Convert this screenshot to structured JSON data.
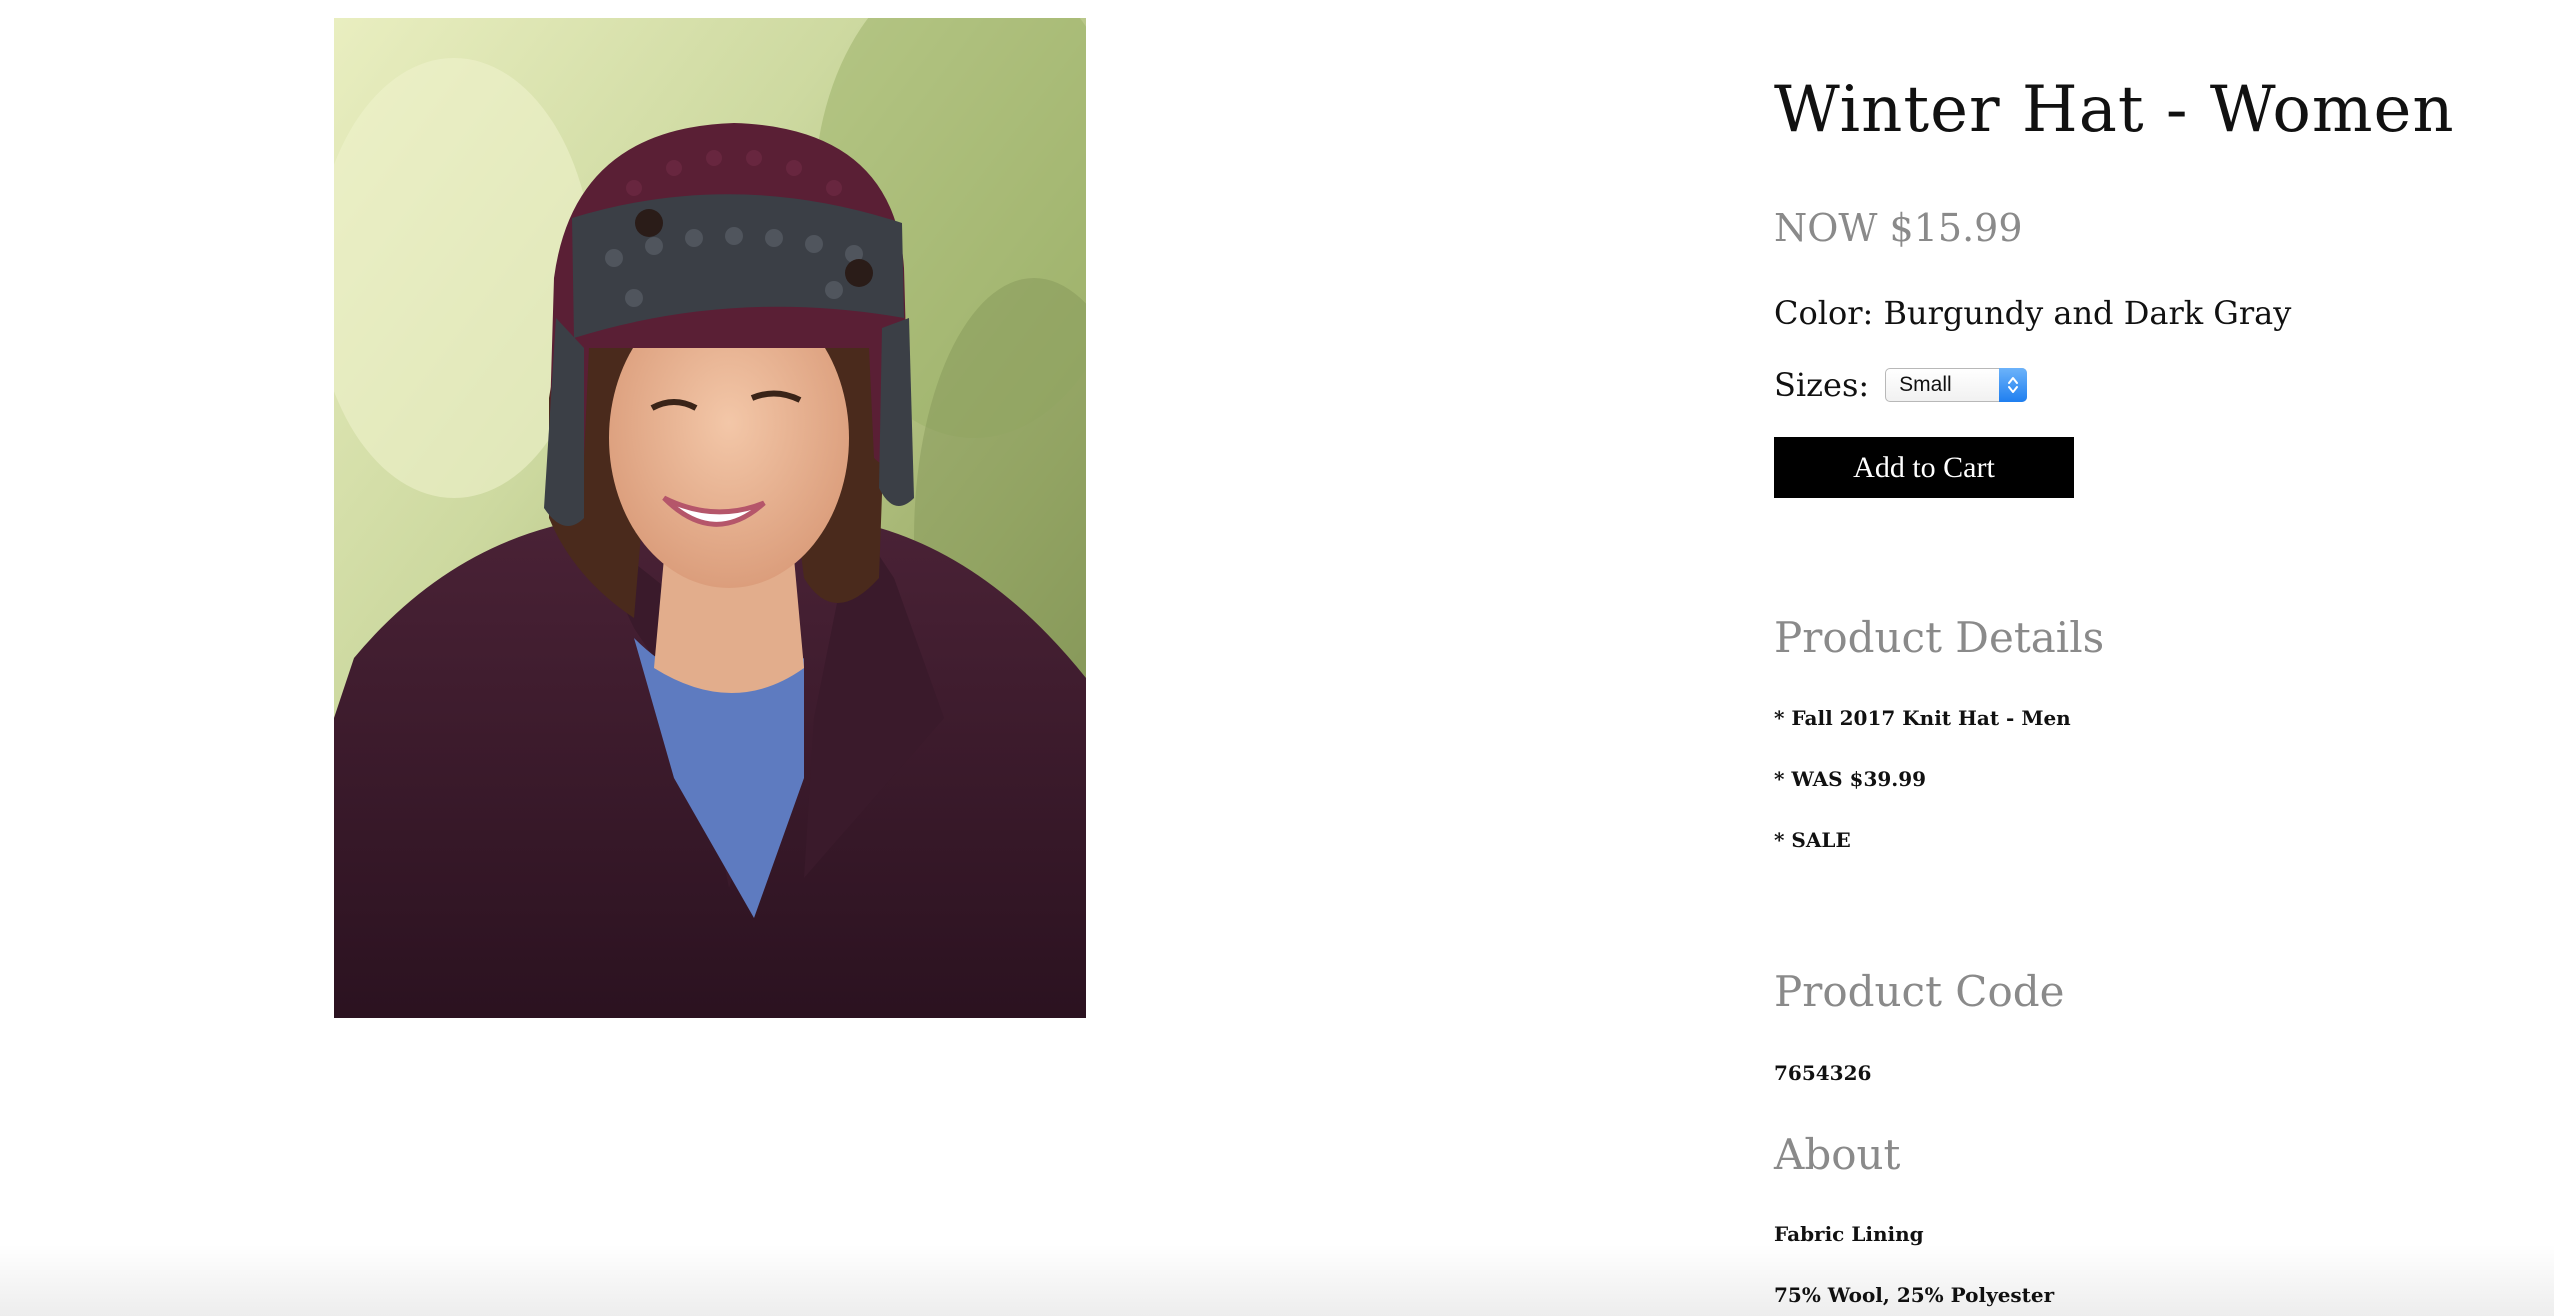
{
  "product": {
    "title": "Winter Hat - Women",
    "price": "NOW $15.99",
    "color": "Color: Burgundy and Dark Gray",
    "sizes_label": "Sizes:",
    "size_selected": "Small",
    "add_to_cart": "Add to Cart",
    "photo_icon": "product-photo"
  },
  "details": {
    "heading": "Product Details",
    "items": [
      "* Fall 2017 Knit Hat - Men",
      "* WAS $39.99",
      "* SALE"
    ]
  },
  "code": {
    "heading": "Product Code",
    "value": "7654326"
  },
  "about": {
    "heading": "About",
    "lines": [
      "Fabric Lining",
      "75% Wool, 25% Polyester"
    ]
  },
  "colors": {
    "button_bg": "#000000",
    "heading_gray": "#8a8a8a",
    "select_accent": "#1f7ff0"
  }
}
